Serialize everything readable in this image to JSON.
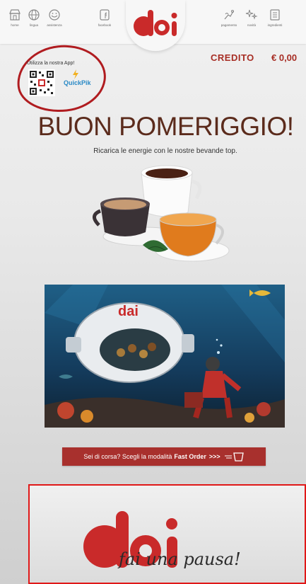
{
  "nav": {
    "left": [
      {
        "label": "home",
        "icon": "shop-icon"
      },
      {
        "label": "lingua",
        "icon": "globe-icon"
      },
      {
        "label": "assistenza",
        "icon": "support-icon"
      },
      {
        "label": "facebook",
        "icon": "facebook-icon"
      }
    ],
    "right": [
      {
        "label": "pagamento",
        "icon": "payment-icon"
      },
      {
        "label": "novità",
        "icon": "sparkle-icon"
      },
      {
        "label": "ingredienti",
        "icon": "ingredients-icon"
      }
    ]
  },
  "brand": {
    "logo_text": "dai",
    "tagline": "fai una pausa!",
    "color": "#c92a2a"
  },
  "app_promo": {
    "label": "Utilizza la nostra App!",
    "app_name": "QuickPik"
  },
  "credit": {
    "label": "CREDITO",
    "value": "€ 0,00"
  },
  "greeting": {
    "title": "BUON POMERIGGIO!",
    "subtitle": "Ricarica le energie con le nostre bevande top."
  },
  "hero": {
    "logo_text": "dai"
  },
  "fast_order": {
    "prefix": "Sei di corsa? Scegli la modalità",
    "highlight": "Fast Order",
    "chevrons": ">>>"
  },
  "colors": {
    "accent": "#a8302d",
    "brand_red": "#c92a2a",
    "title_brown": "#5b2b1c"
  }
}
